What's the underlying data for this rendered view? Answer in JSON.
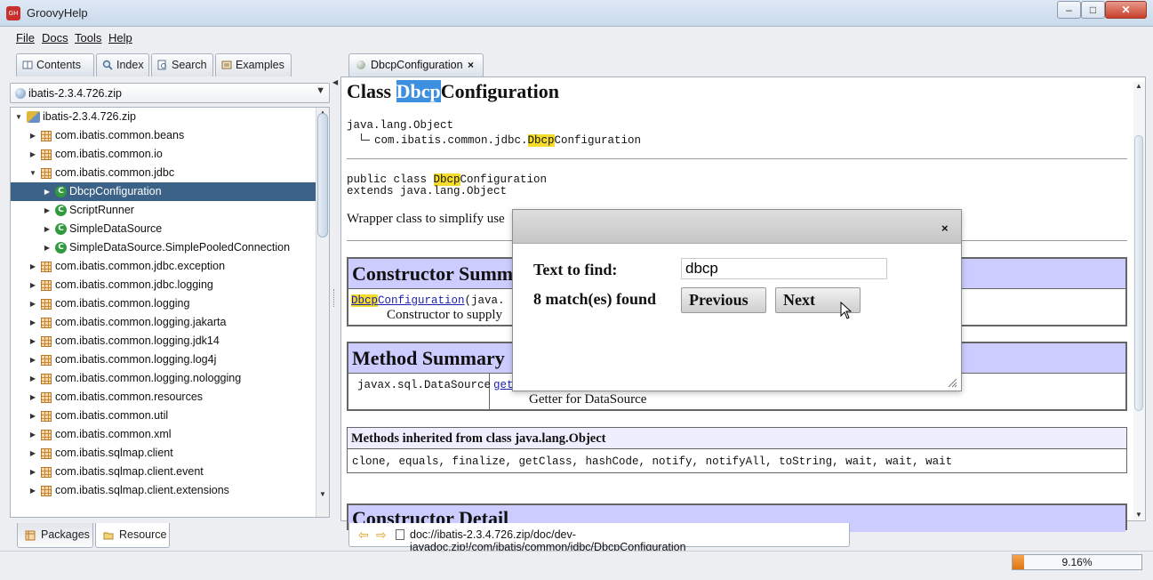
{
  "app": {
    "title": "GroovyHelp",
    "icon_label": "GH"
  },
  "menu": [
    "File",
    "Docs",
    "Tools",
    "Help"
  ],
  "left_tabs": [
    {
      "label": "Contents",
      "icon": "book-icon"
    },
    {
      "label": "Index",
      "icon": "magnifier-icon"
    },
    {
      "label": "Search",
      "icon": "search-doc-icon"
    },
    {
      "label": "Examples",
      "icon": "examples-icon"
    }
  ],
  "library_select": {
    "value": "ibatis-2.3.4.726.zip"
  },
  "tree": [
    {
      "label": "ibatis-2.3.4.726.zip",
      "type": "root",
      "expanded": true
    },
    {
      "label": "com.ibatis.common.beans",
      "type": "package",
      "expanded": false
    },
    {
      "label": "com.ibatis.common.io",
      "type": "package",
      "expanded": false
    },
    {
      "label": "com.ibatis.common.jdbc",
      "type": "package",
      "expanded": true
    },
    {
      "label": "DbcpConfiguration",
      "type": "class",
      "expanded": false,
      "selected": true
    },
    {
      "label": "ScriptRunner",
      "type": "class",
      "expanded": false
    },
    {
      "label": "SimpleDataSource",
      "type": "class",
      "expanded": false
    },
    {
      "label": "SimpleDataSource.SimplePooledConnection",
      "type": "class",
      "expanded": false
    },
    {
      "label": "com.ibatis.common.jdbc.exception",
      "type": "package",
      "expanded": false
    },
    {
      "label": "com.ibatis.common.jdbc.logging",
      "type": "package",
      "expanded": false
    },
    {
      "label": "com.ibatis.common.logging",
      "type": "package",
      "expanded": false
    },
    {
      "label": "com.ibatis.common.logging.jakarta",
      "type": "package",
      "expanded": false
    },
    {
      "label": "com.ibatis.common.logging.jdk14",
      "type": "package",
      "expanded": false
    },
    {
      "label": "com.ibatis.common.logging.log4j",
      "type": "package",
      "expanded": false
    },
    {
      "label": "com.ibatis.common.logging.nologging",
      "type": "package",
      "expanded": false
    },
    {
      "label": "com.ibatis.common.resources",
      "type": "package",
      "expanded": false
    },
    {
      "label": "com.ibatis.common.util",
      "type": "package",
      "expanded": false
    },
    {
      "label": "com.ibatis.common.xml",
      "type": "package",
      "expanded": false
    },
    {
      "label": "com.ibatis.sqlmap.client",
      "type": "package",
      "expanded": false
    },
    {
      "label": "com.ibatis.sqlmap.client.event",
      "type": "package",
      "expanded": false
    },
    {
      "label": "com.ibatis.sqlmap.client.extensions",
      "type": "package",
      "expanded": false
    }
  ],
  "bottom_tabs": [
    {
      "label": "Packages",
      "icon": "packages-icon"
    },
    {
      "label": "Resource",
      "icon": "resource-icon"
    }
  ],
  "doc_tab": {
    "label": "DbcpConfiguration",
    "close": "×"
  },
  "doc": {
    "title_pre": "Class ",
    "title_hl": "Dbcp",
    "title_post": "Configuration",
    "hier_parent": "java.lang.Object",
    "hier_child_pre": "com.ibatis.common.jdbc.",
    "hier_child_hl": "Dbcp",
    "hier_child_post": "Configuration",
    "decl_pre": "public class ",
    "decl_hl": "Dbcp",
    "decl_post": "Configuration",
    "decl_extends": "extends java.lang.Object",
    "description": "Wrapper class to simplify use",
    "ctor_summary_title": "Constructor Summ",
    "ctor_hl": "Dbcp",
    "ctor_link": "Configuration",
    "ctor_args": "(java.",
    "ctor_desc": "Constructor to supply",
    "method_summary_title": "Method Summary",
    "method_type": "javax.sql.DataSource",
    "method_link": "get",
    "method_desc": "Getter for DataSource",
    "inherited_title": "Methods inherited from class java.lang.Object",
    "inherited_methods": "clone, equals, finalize, getClass, hashCode, notify, notifyAll, toString, wait, wait, wait",
    "detail_title": "Constructor Detail"
  },
  "find_dialog": {
    "close": "×",
    "label": "Text to find:",
    "value": "dbcp",
    "count": "8 match(es) found",
    "previous": "Previous",
    "next": "Next"
  },
  "address": "doc://ibatis-2.3.4.726.zip/doc/dev-javadoc.zip!/com/ibatis/common/jdbc/DbcpConfiguration",
  "status": {
    "progress_label": "9.16%",
    "progress_value": 0.0916
  }
}
